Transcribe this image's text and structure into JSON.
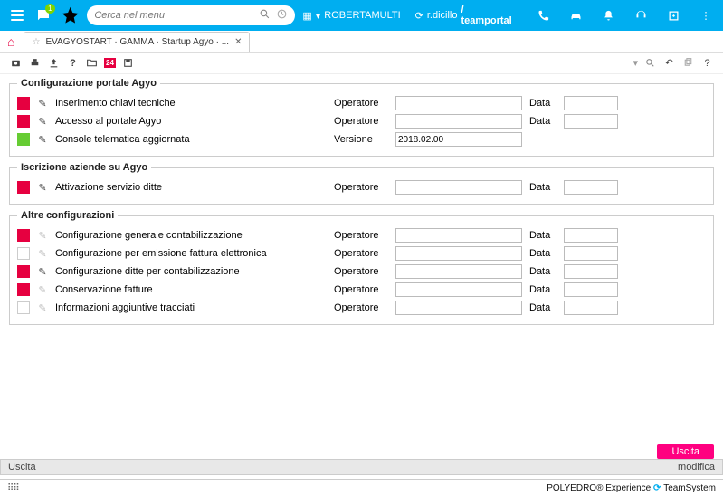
{
  "header": {
    "search_placeholder": "Cerca nel menu",
    "user_menu_label": "ROBERTAMULTI",
    "context_prefix": "r.dicillo",
    "context_app": "/ teamportal",
    "msg_badge": "1"
  },
  "tab": {
    "title": "EVAGYOSTART · GAMMA · Startup Agyo · ..."
  },
  "toolbar": {
    "red_badge": "24"
  },
  "sections": [
    {
      "legend": "Configurazione portale Agyo",
      "rows": [
        {
          "status": "red",
          "edit": true,
          "label": "Inserimento chiavi tecniche",
          "col1": "Operatore",
          "val1": "",
          "col2": "Data",
          "val2": ""
        },
        {
          "status": "red",
          "edit": true,
          "label": "Accesso al portale Agyo",
          "col1": "Operatore",
          "val1": "",
          "col2": "Data",
          "val2": ""
        },
        {
          "status": "green",
          "edit": true,
          "label": "Console telematica aggiornata",
          "col1": "Versione",
          "val1": "2018.02.00",
          "col2": "",
          "val2": ""
        }
      ]
    },
    {
      "legend": "Iscrizione aziende su Agyo",
      "rows": [
        {
          "status": "red",
          "edit": true,
          "label": "Attivazione servizio ditte",
          "col1": "Operatore",
          "val1": "",
          "col2": "Data",
          "val2": ""
        }
      ]
    },
    {
      "legend": "Altre configurazioni",
      "rows": [
        {
          "status": "red",
          "edit": false,
          "label": "Configurazione generale contabilizzazione",
          "col1": "Operatore",
          "val1": "",
          "col2": "Data",
          "val2": ""
        },
        {
          "status": "empty",
          "edit": false,
          "label": "Configurazione per emissione fattura elettronica",
          "col1": "Operatore",
          "val1": "",
          "col2": "Data",
          "val2": ""
        },
        {
          "status": "red",
          "edit": true,
          "label": "Configurazione ditte per contabilizzazione",
          "col1": "Operatore",
          "val1": "",
          "col2": "Data",
          "val2": ""
        },
        {
          "status": "red",
          "edit": false,
          "label": "Conservazione fatture",
          "col1": "Operatore",
          "val1": "",
          "col2": "Data",
          "val2": ""
        },
        {
          "status": "empty",
          "edit": false,
          "label": "Informazioni aggiuntive tracciati",
          "col1": "Operatore",
          "val1": "",
          "col2": "Data",
          "val2": ""
        }
      ]
    }
  ],
  "buttons": {
    "uscita": "Uscita"
  },
  "statusbar": {
    "left": "Uscita",
    "right": "modifica"
  },
  "footer": {
    "brand": "POLYEDRO® Experience",
    "brand2": "TeamSystem"
  }
}
